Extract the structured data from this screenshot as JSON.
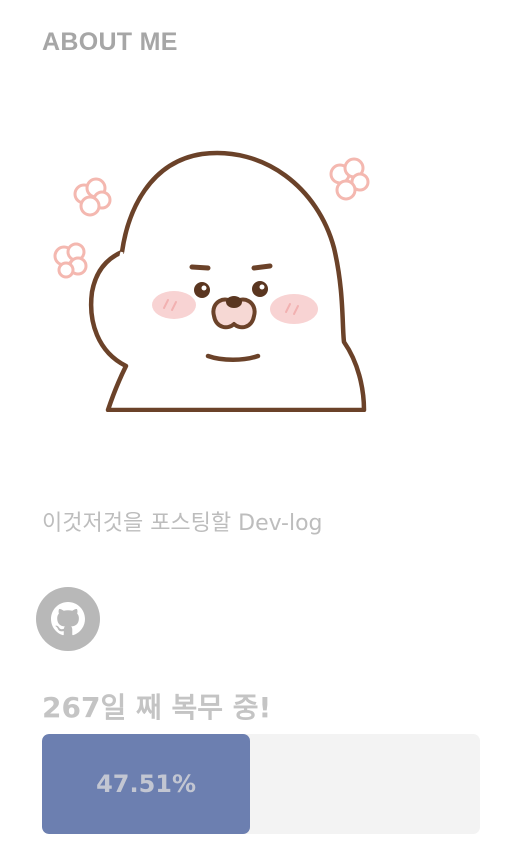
{
  "about": {
    "heading": "ABOUT ME",
    "bio": "이것저것을 포스팅할 Dev-log"
  },
  "avatar": {
    "icon": "seal-character-illustration"
  },
  "social": {
    "github": {
      "icon": "github-icon"
    }
  },
  "service": {
    "title": "267일 째 복무 중!",
    "progress_label": "47.51%",
    "progress_percent": 47.51,
    "bar_color": "#6c7fb0",
    "track_color": "#f3f3f3"
  }
}
